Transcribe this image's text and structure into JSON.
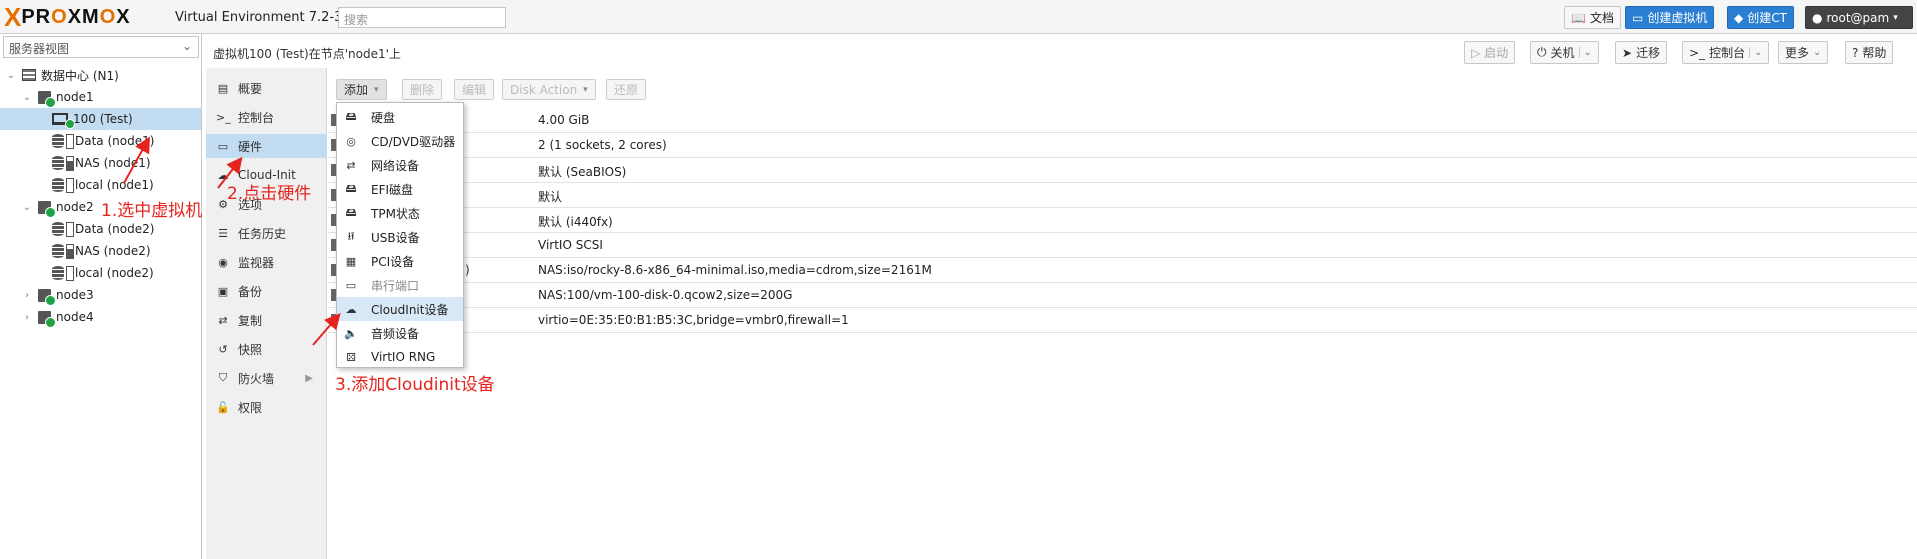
{
  "topbar": {
    "logo_x": "X",
    "logo_text_a": "PR",
    "logo_text_o": "O",
    "logo_text_b": "XM",
    "logo_text_c": "O",
    "logo_text_d": "X",
    "version": "Virtual Environment 7.2-3",
    "search_placeholder": "搜索",
    "docs": "文档",
    "create_vm": "创建虚拟机",
    "create_ct": "创建CT",
    "user": "root@pam"
  },
  "tree": {
    "view_selector": "服务器视图",
    "items": [
      {
        "label": "数据中心 (N1)"
      },
      {
        "label": "node1"
      },
      {
        "label": "100 (Test)"
      },
      {
        "label": "Data (node1)"
      },
      {
        "label": "NAS (node1)"
      },
      {
        "label": "local (node1)"
      },
      {
        "label": "node2"
      },
      {
        "label": "Data (node2)"
      },
      {
        "label": "NAS (node2)"
      },
      {
        "label": "local (node2)"
      },
      {
        "label": "node3"
      },
      {
        "label": "node4"
      }
    ]
  },
  "header": {
    "breadcrumb": "虚拟机100 (Test)在节点'node1'上",
    "start": "启动",
    "shutdown": "关机",
    "migrate": "迁移",
    "console": "控制台",
    "more": "更多",
    "help": "帮助"
  },
  "nav": {
    "items": [
      {
        "label": "概要"
      },
      {
        "label": "控制台"
      },
      {
        "label": "硬件"
      },
      {
        "label": "Cloud-Init"
      },
      {
        "label": "选项"
      },
      {
        "label": "任务历史"
      },
      {
        "label": "监视器"
      },
      {
        "label": "备份"
      },
      {
        "label": "复制"
      },
      {
        "label": "快照"
      },
      {
        "label": "防火墙"
      },
      {
        "label": "权限"
      }
    ]
  },
  "toolbar": {
    "add": "添加",
    "remove": "删除",
    "edit": "编辑",
    "disk_action": "Disk Action",
    "revert": "还原"
  },
  "hardware": {
    "rows": [
      {
        "key": "",
        "value": "4.00 GiB"
      },
      {
        "key": "",
        "value": "2 (1 sockets, 2 cores)"
      },
      {
        "key": "",
        "value": "默认 (SeaBIOS)"
      },
      {
        "key": "",
        "value": "默认"
      },
      {
        "key": "",
        "value": "默认 (i440fx)"
      },
      {
        "key": "",
        "value": "VirtIO SCSI"
      },
      {
        "key": "e2)",
        "value": "NAS:iso/rocky-8.6-x86_64-minimal.iso,media=cdrom,size=2161M"
      },
      {
        "key": "",
        "value": "NAS:100/vm-100-disk-0.qcow2,size=200G"
      },
      {
        "key": "",
        "value": "virtio=0E:35:E0:B1:B5:3C,bridge=vmbr0,firewall=1"
      }
    ]
  },
  "add_menu": {
    "items": [
      {
        "label": "硬盘",
        "icon": "hdd-icon"
      },
      {
        "label": "CD/DVD驱动器",
        "icon": "cdrom-icon"
      },
      {
        "label": "网络设备",
        "icon": "network-icon"
      },
      {
        "label": "EFI磁盘",
        "icon": "hdd-icon"
      },
      {
        "label": "TPM状态",
        "icon": "hdd-icon"
      },
      {
        "label": "USB设备",
        "icon": "usb-icon"
      },
      {
        "label": "PCI设备",
        "icon": "pci-icon"
      },
      {
        "label": "串行端口",
        "icon": "serial-icon"
      },
      {
        "label": "CloudInit设备",
        "icon": "cloud-icon"
      },
      {
        "label": "音频设备",
        "icon": "audio-icon"
      },
      {
        "label": "VirtIO RNG",
        "icon": "dice-icon"
      }
    ]
  },
  "annotations": {
    "step1": "1.选中虚拟机",
    "step2": "2.点击硬件",
    "step3": "3.添加Cloudinit设备"
  },
  "colors": {
    "accent_orange": "#e57000",
    "selection_blue": "#c2ddf2",
    "annotation_red": "#e6231e",
    "button_blue": "#2b7fd2",
    "status_green": "#21a345"
  }
}
